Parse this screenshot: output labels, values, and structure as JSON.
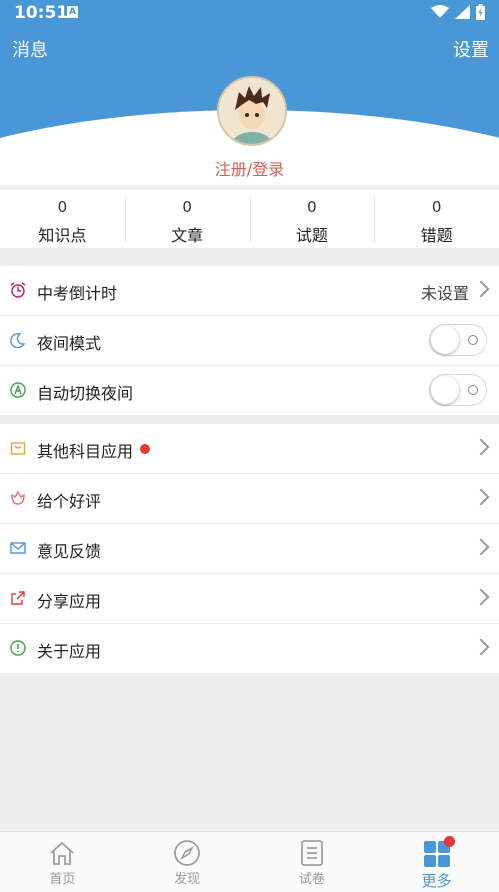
{
  "status_bar": {
    "time": "10:51",
    "a_badge": "A"
  },
  "header": {
    "left": "消息",
    "right": "设置"
  },
  "profile": {
    "login": "注册/登录"
  },
  "stats": [
    {
      "value": "0",
      "label": "知识点"
    },
    {
      "value": "0",
      "label": "文章"
    },
    {
      "value": "0",
      "label": "试题"
    },
    {
      "value": "0",
      "label": "错题"
    }
  ],
  "section1": {
    "countdown": {
      "label": "中考倒计时",
      "value": "未设置"
    },
    "night_mode": {
      "label": "夜间模式",
      "on": false
    },
    "auto_night": {
      "label": "自动切换夜间",
      "on": false
    }
  },
  "section2": {
    "other_apps": {
      "label": "其他科目应用"
    },
    "rate": {
      "label": "给个好评"
    },
    "feedback": {
      "label": "意见反馈"
    },
    "share": {
      "label": "分享应用"
    },
    "about": {
      "label": "关于应用"
    }
  },
  "tabbar": {
    "home": "首页",
    "discover": "发现",
    "papers": "试卷",
    "more": "更多"
  },
  "colors": {
    "primary": "#4a97d8",
    "accent_red": "#d05f56",
    "badge": "#e53935"
  }
}
